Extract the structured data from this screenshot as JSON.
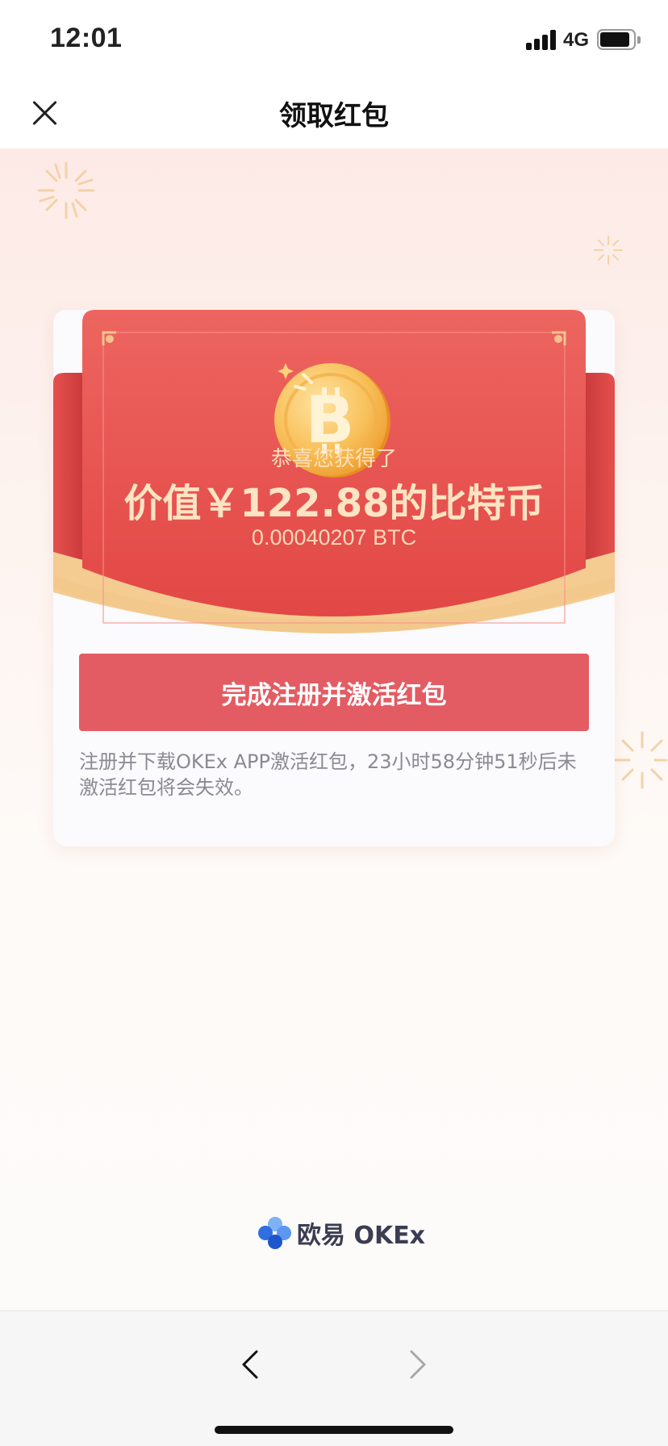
{
  "status_bar": {
    "time": "12:01",
    "network": "4G",
    "icons": [
      "signal-icon",
      "battery-icon"
    ]
  },
  "header": {
    "title": "领取红包",
    "close_icon": "close-icon"
  },
  "red_packet": {
    "coin_icon": "bitcoin-coin-icon",
    "coin_symbol": "B",
    "congrats": "恭喜您获得了",
    "value": "价值￥122.88的比特币",
    "btc_amount": "0.00040207 BTC"
  },
  "activate_button": {
    "label": "完成注册并激活红包"
  },
  "notice": "注册并下载OKEx APP激活红包，23小时58分钟51秒后未激活红包将会失效。",
  "brand": {
    "logo_icon": "okex-logo-icon",
    "name": "欧易 OKEx"
  },
  "bottom_bar": {
    "back_icon": "chevron-left-icon",
    "forward_icon": "chevron-right-icon"
  },
  "colors": {
    "packet_red": "#e8494a",
    "button_red": "#e35c63",
    "gold": "#f7c56f",
    "text_gold": "#fde4c2"
  }
}
